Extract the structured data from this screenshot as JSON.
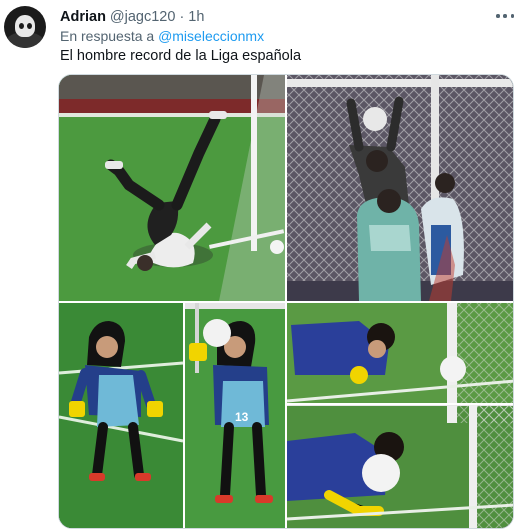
{
  "tweet": {
    "author_name": "Adrian",
    "author_handle": "@jagc120",
    "separator": "·",
    "time": "1h",
    "reply_prefix": "En respuesta a",
    "reply_mention": "@miseleccionmx",
    "text": "El hombre record de la Liga española",
    "jersey_number": "13"
  },
  "icons": {
    "more": "more-horizontal-icon",
    "avatar": "avatar-image"
  },
  "colors": {
    "link": "#1d9bf0",
    "secondary_text": "#536471",
    "primary_text": "#0f1419",
    "pitch_green": "#3f8f3a"
  }
}
